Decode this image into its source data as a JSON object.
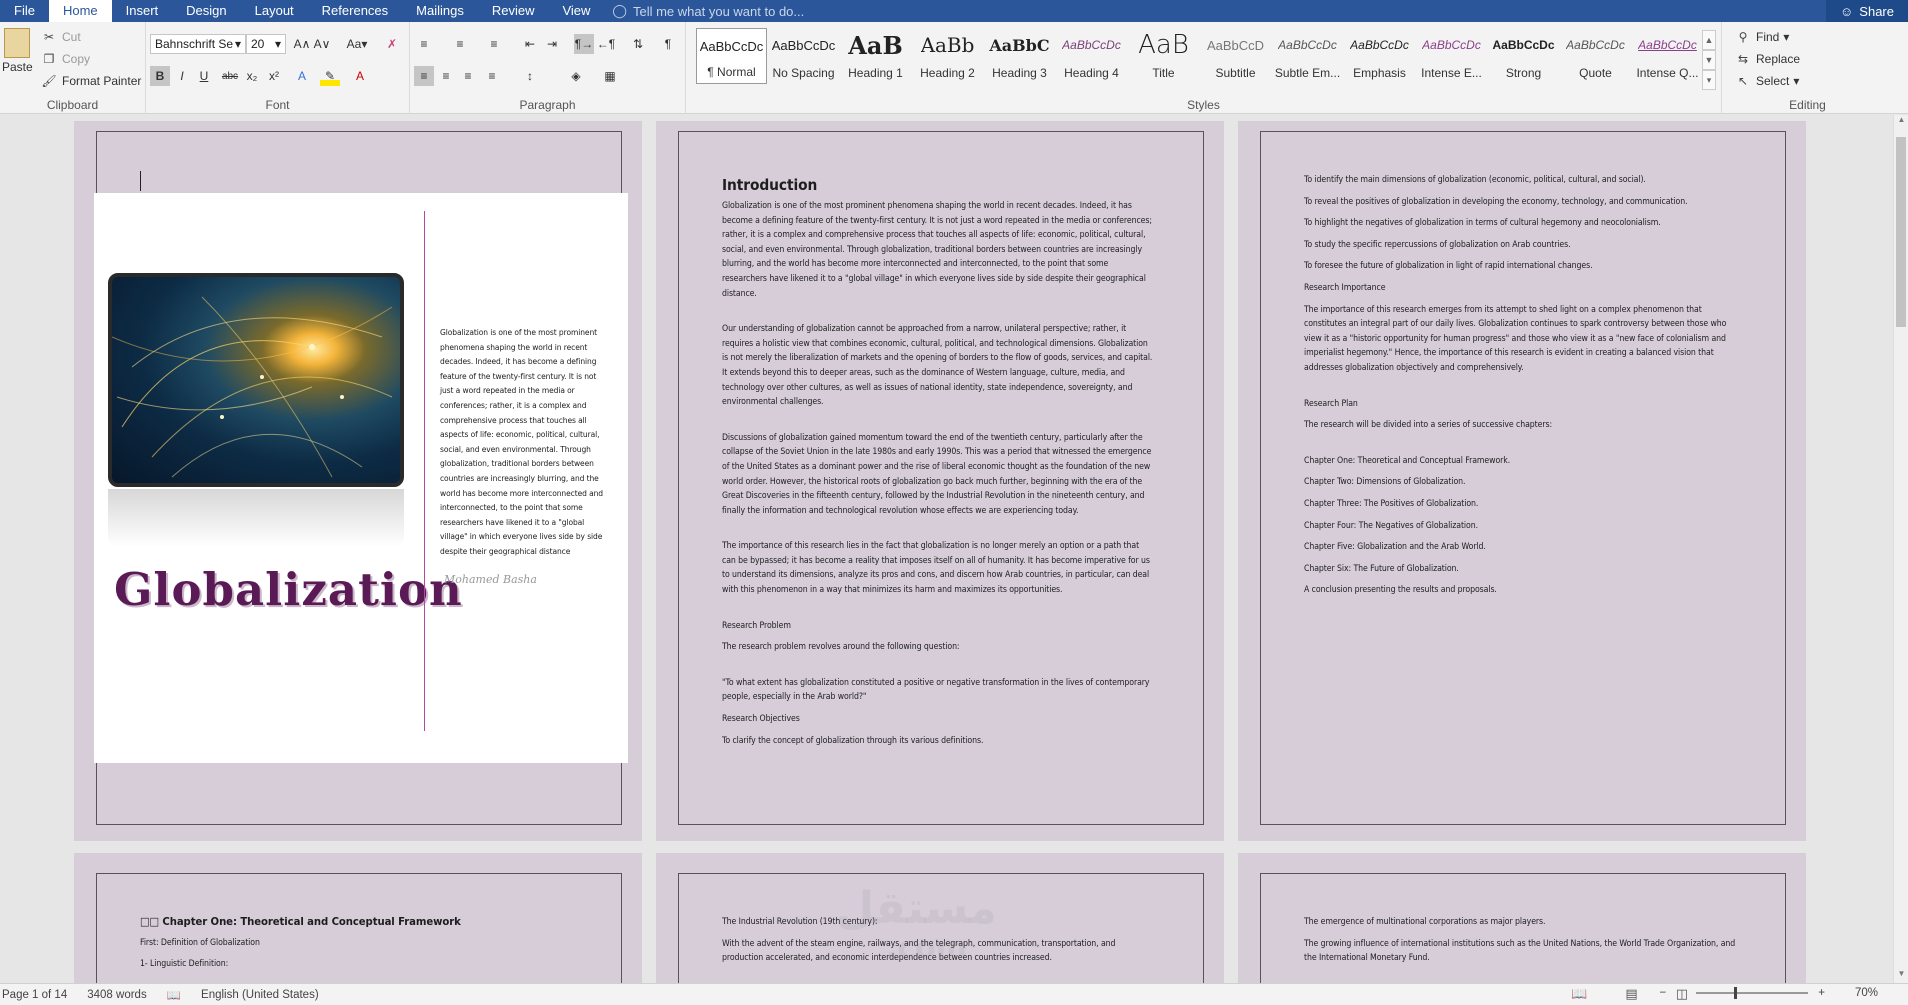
{
  "tabs": {
    "file": "File",
    "home": "Home",
    "insert": "Insert",
    "design": "Design",
    "layout": "Layout",
    "references": "References",
    "mailings": "Mailings",
    "review": "Review",
    "view": "View"
  },
  "tell_me": "Tell me what you want to do...",
  "share": "Share",
  "clipboard": {
    "paste": "Paste",
    "cut": "Cut",
    "copy": "Copy",
    "format_painter": "Format Painter",
    "label": "Clipboard"
  },
  "font": {
    "name": "Bahnschrift Se",
    "size": "20",
    "label": "Font",
    "case": "Aa"
  },
  "paragraph": {
    "label": "Paragraph"
  },
  "styles": {
    "label": "Styles",
    "items": [
      {
        "preview": "AaBbCcDc",
        "name": "¶ Normal"
      },
      {
        "preview": "AaBbCcDc",
        "name": "No Spacing"
      },
      {
        "preview": "AaB",
        "name": "Heading 1"
      },
      {
        "preview": "AaBb",
        "name": "Heading 2"
      },
      {
        "preview": "AaBbC",
        "name": "Heading 3"
      },
      {
        "preview": "AaBbCcDc",
        "name": "Heading 4"
      },
      {
        "preview": "AaB",
        "name": "Title"
      },
      {
        "preview": "AaBbCcD",
        "name": "Subtitle"
      },
      {
        "preview": "AaBbCcDc",
        "name": "Subtle Em..."
      },
      {
        "preview": "AaBbCcDc",
        "name": "Emphasis"
      },
      {
        "preview": "AaBbCcDc",
        "name": "Intense E..."
      },
      {
        "preview": "AaBbCcDc",
        "name": "Strong"
      },
      {
        "preview": "AaBbCcDc",
        "name": "Quote"
      },
      {
        "preview": "AaBbCcDc",
        "name": "Intense Q..."
      }
    ]
  },
  "editing": {
    "find": "Find",
    "replace": "Replace",
    "select": "Select",
    "label": "Editing"
  },
  "page1": {
    "cover_text": "Globalization is one of the most prominent phenomena shaping the world in recent decades. Indeed, it has become a defining feature of the twenty-first century. It is not just a word repeated in the media or conferences; rather, it is a complex and comprehensive process that touches all aspects of life: economic, political, cultural, social, and even environmental. Through globalization, traditional borders between countries are increasingly blurring, and the world has become more interconnected and interconnected, to the point that some researchers have likened it to a \"global village\" in which everyone lives side by side despite their geographical distance",
    "title": "Globalization",
    "author": "Mohamed Basha"
  },
  "page2": {
    "heading": "Introduction",
    "p1": "Globalization is one of the most prominent phenomena shaping the world in recent decades. Indeed, it has become a defining feature of the twenty-first century. It is not just a word repeated in the media or conferences; rather, it is a complex and comprehensive process that touches all aspects of life: economic, political, cultural, social, and even environmental. Through globalization, traditional borders between countries are increasingly blurring, and the world has become more interconnected and interconnected, to the point that some researchers have likened it to a \"global village\" in which everyone lives side by side despite their geographical distance.",
    "p2": "Our understanding of globalization cannot be approached from a narrow, unilateral perspective; rather, it requires a holistic view that combines economic, cultural, political, and technological dimensions. Globalization is not merely the liberalization of markets and the opening of borders to the flow of goods, services, and capital. It extends beyond this to deeper areas, such as the dominance of Western language, culture, media, and technology over other cultures, as well as issues of national identity, state independence, sovereignty, and environmental challenges.",
    "p3": "Discussions of globalization gained momentum toward the end of the twentieth century, particularly after the collapse of the Soviet Union in the late 1980s and early 1990s. This was a period that witnessed the emergence of the United States as a dominant power and the rise of liberal economic thought as the foundation of the new world order. However, the historical roots of globalization go back much further, beginning with the era of the Great Discoveries in the fifteenth century, followed by the Industrial Revolution in the nineteenth century, and finally the information and technological revolution whose effects we are experiencing today.",
    "p4": "The importance of this research lies in the fact that globalization is no longer merely an option or a path that can be bypassed; it has become a reality that imposes itself on all of humanity. It has become imperative for us to understand its dimensions, analyze its pros and cons, and discern how Arab countries, in particular, can deal with this phenomenon in a way that minimizes its harm and maximizes its opportunities.",
    "h_problem": "Research Problem",
    "p5": "The research problem revolves around the following question:",
    "p6": "\"To what extent has globalization constituted a positive or negative transformation in the lives of contemporary people, especially in the Arab world?\"",
    "h_objectives": "Research Objectives",
    "p7": "To clarify the concept of globalization through its various definitions."
  },
  "page3": {
    "o1": "To identify the main dimensions of globalization (economic, political, cultural, and social).",
    "o2": "To reveal the positives of globalization in developing the economy, technology, and communication.",
    "o3": "To highlight the negatives of globalization in terms of cultural hegemony and neocolonialism.",
    "o4": "To study the specific repercussions of globalization on Arab countries.",
    "o5": "To foresee the future of globalization in light of rapid international changes.",
    "h_importance": "Research Importance",
    "p_importance": "The importance of this research emerges from its attempt to shed light on a complex phenomenon that constitutes an integral part of our daily lives. Globalization continues to spark controversy between those who view it as a \"historic opportunity for human progress\" and those who view it as a \"new face of colonialism and imperialist hegemony.\" Hence, the importance of this research is evident in creating a balanced vision that addresses globalization objectively and comprehensively.",
    "h_plan": "Research Plan",
    "p_plan": "The research will be divided into a series of successive chapters:",
    "c1": "Chapter One: Theoretical and Conceptual Framework.",
    "c2": "Chapter Two: Dimensions of Globalization.",
    "c3": "Chapter Three: The Positives of Globalization.",
    "c4": "Chapter Four: The Negatives of Globalization.",
    "c5": "Chapter Five: Globalization and the Arab World.",
    "c6": "Chapter Six: The Future of Globalization.",
    "c7": "A conclusion presenting the results and proposals."
  },
  "page4": {
    "heading": "□□ Chapter One: Theoretical and Conceptual Framework",
    "l1": "First: Definition of Globalization",
    "l2": "1- Linguistic Definition:"
  },
  "page5": {
    "l1": "The Industrial Revolution (19th century):",
    "l2": "With the advent of the steam engine, railways, and the telegraph, communication, transportation, and production accelerated, and economic interdependence between countries increased."
  },
  "page6": {
    "l1": "The emergence of multinational corporations as major players.",
    "l2": "The growing influence of international institutions such as the United Nations, the World Trade Organization, and the International Monetary Fund."
  },
  "status": {
    "page": "Page 1 of 14",
    "words": "3408 words",
    "language": "English (United States)",
    "zoom": "70%"
  }
}
